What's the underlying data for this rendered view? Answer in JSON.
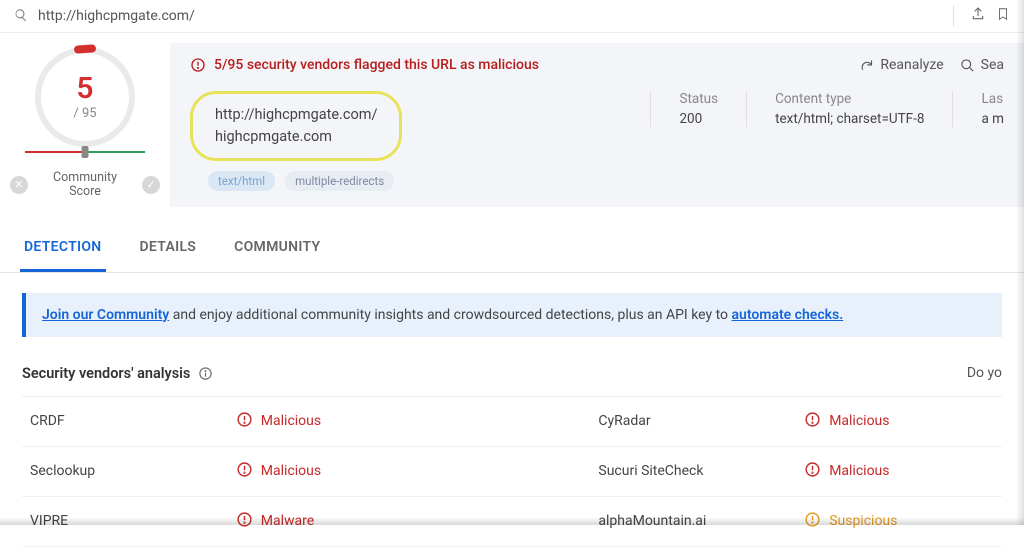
{
  "topbar": {
    "url": "http://highcpmgate.com/"
  },
  "score": {
    "detections": "5",
    "total": "/ 95",
    "community_label": "Community Score"
  },
  "flag": {
    "text": "5/95 security vendors flagged this URL as malicious",
    "reanalyze": "Reanalyze",
    "search": "Sea"
  },
  "url_card": {
    "line1": "http://highcpmgate.com/",
    "line2": "highcpmgate.com"
  },
  "meta": {
    "status_lbl": "Status",
    "status_val": "200",
    "ctype_lbl": "Content type",
    "ctype_val": "text/html; charset=UTF-8",
    "last_lbl": "Las",
    "last_val": "a m"
  },
  "tags": {
    "a": "text/html",
    "b": "multiple-redirects"
  },
  "tabs": {
    "detection": "DETECTION",
    "details": "DETAILS",
    "community": "COMMUNITY"
  },
  "banner": {
    "link1": "Join our Community",
    "mid": " and enjoy additional community insights and crowdsourced detections, plus an API key to ",
    "link2": "automate checks."
  },
  "vendors": {
    "heading": "Security vendors' analysis",
    "right": "Do yo",
    "rows": [
      {
        "v1": "CRDF",
        "r1": "Malicious",
        "k1": "mal",
        "v2": "CyRadar",
        "r2": "Malicious",
        "k2": "mal"
      },
      {
        "v1": "Seclookup",
        "r1": "Malicious",
        "k1": "mal",
        "v2": "Sucuri SiteCheck",
        "r2": "Malicious",
        "k2": "mal"
      },
      {
        "v1": "VIPRE",
        "r1": "Malware",
        "k1": "mal",
        "v2": "alphaMountain.ai",
        "r2": "Suspicious",
        "k2": "sus"
      }
    ]
  }
}
